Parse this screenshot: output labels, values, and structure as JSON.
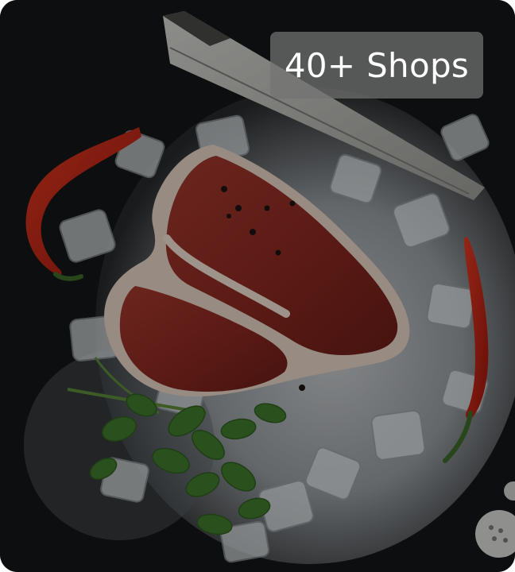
{
  "card": {
    "image_description": "meat-on-ice-photo",
    "badge_label": "40+ Shops"
  }
}
